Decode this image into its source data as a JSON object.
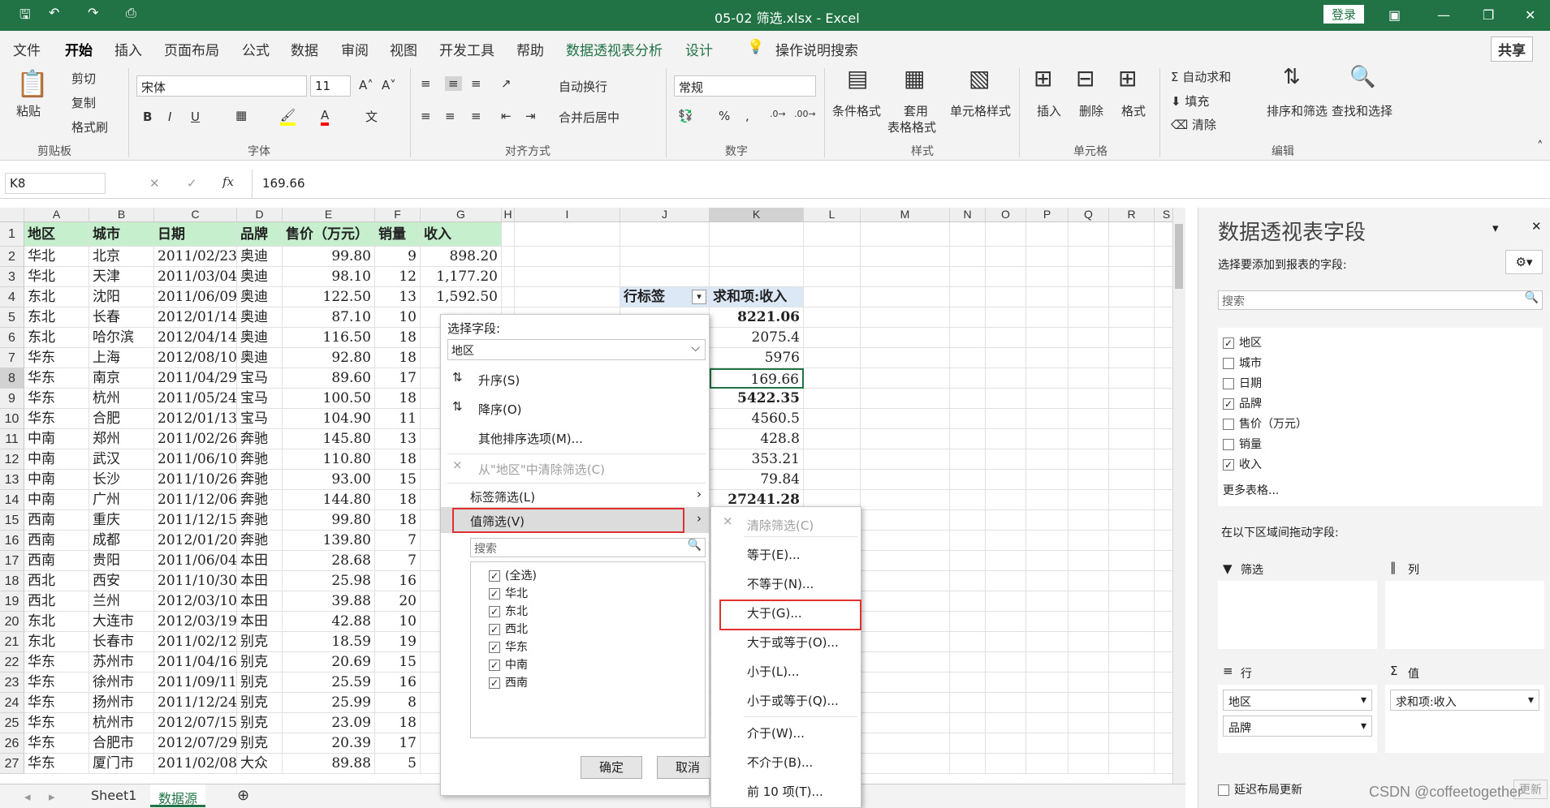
{
  "title": "05-02 筛选.xlsx - Excel",
  "login": "登录",
  "tabs": [
    "文件",
    "开始",
    "插入",
    "页面布局",
    "公式",
    "数据",
    "审阅",
    "视图",
    "开发工具",
    "帮助",
    "数据透视表分析",
    "设计"
  ],
  "tellme": "操作说明搜索",
  "share": "共享",
  "ribbon": {
    "paste": "粘贴",
    "cut": "剪切",
    "copy": "复制",
    "format_painter": "格式刷",
    "clipboard": "剪贴板",
    "font_name": "宋体",
    "font_size": "11",
    "font_group": "字体",
    "wrap": "自动换行",
    "merge": "合并后居中",
    "align_group": "对齐方式",
    "number_format": "常规",
    "number_group": "数字",
    "cond_format": "条件格式",
    "table_format_1": "套用",
    "table_format_2": "表格格式",
    "cell_style": "单元格样式",
    "style_group": "样式",
    "insert": "插入",
    "delete": "删除",
    "format": "格式",
    "cells_group": "单元格",
    "autosum": "自动求和",
    "fill": "填充",
    "clear": "清除",
    "sort_filter": "排序和筛选",
    "find_select": "查找和选择",
    "edit_group": "编辑"
  },
  "formula_bar": {
    "namebox": "K8",
    "formula": "169.66"
  },
  "columns": [
    "A",
    "B",
    "C",
    "D",
    "E",
    "F",
    "G",
    "H",
    "I",
    "J",
    "K",
    "L",
    "M",
    "N",
    "O",
    "P",
    "Q",
    "R",
    "S"
  ],
  "headers": [
    "地区",
    "城市",
    "日期",
    "品牌",
    "售价（万元）",
    "销量",
    "收入"
  ],
  "rows": [
    [
      "华北",
      "北京",
      "2011/02/23",
      "奥迪",
      "99.80",
      "9",
      "898.20"
    ],
    [
      "华北",
      "天津",
      "2011/03/04",
      "奥迪",
      "98.10",
      "12",
      "1,177.20"
    ],
    [
      "东北",
      "沈阳",
      "2011/06/09",
      "奥迪",
      "122.50",
      "13",
      "1,592.50"
    ],
    [
      "东北",
      "长春",
      "2012/01/14",
      "奥迪",
      "87.10",
      "10",
      ""
    ],
    [
      "东北",
      "哈尔滨",
      "2012/04/14",
      "奥迪",
      "116.50",
      "18",
      ""
    ],
    [
      "华东",
      "上海",
      "2012/08/10",
      "奥迪",
      "92.80",
      "18",
      ""
    ],
    [
      "华东",
      "南京",
      "2011/04/29",
      "宝马",
      "89.60",
      "17",
      ""
    ],
    [
      "华东",
      "杭州",
      "2011/05/24",
      "宝马",
      "100.50",
      "18",
      ""
    ],
    [
      "华东",
      "合肥",
      "2012/01/13",
      "宝马",
      "104.90",
      "11",
      ""
    ],
    [
      "中南",
      "郑州",
      "2011/02/26",
      "奔驰",
      "145.80",
      "13",
      ""
    ],
    [
      "中南",
      "武汉",
      "2011/06/10",
      "奔驰",
      "110.80",
      "18",
      ""
    ],
    [
      "中南",
      "长沙",
      "2011/10/26",
      "奔驰",
      "93.00",
      "15",
      ""
    ],
    [
      "中南",
      "广州",
      "2011/12/06",
      "奔驰",
      "144.80",
      "18",
      ""
    ],
    [
      "西南",
      "重庆",
      "2011/12/15",
      "奔驰",
      "99.80",
      "18",
      ""
    ],
    [
      "西南",
      "成都",
      "2012/01/20",
      "奔驰",
      "139.80",
      "7",
      ""
    ],
    [
      "西南",
      "贵阳",
      "2011/06/04",
      "本田",
      "28.68",
      "7",
      ""
    ],
    [
      "西北",
      "西安",
      "2011/10/30",
      "本田",
      "25.98",
      "16",
      ""
    ],
    [
      "西北",
      "兰州",
      "2012/03/10",
      "本田",
      "39.88",
      "20",
      ""
    ],
    [
      "东北",
      "大连市",
      "2012/03/19",
      "本田",
      "42.88",
      "10",
      ""
    ],
    [
      "东北",
      "长春市",
      "2011/02/12",
      "别克",
      "18.59",
      "19",
      ""
    ],
    [
      "华东",
      "苏州市",
      "2011/04/16",
      "别克",
      "20.69",
      "15",
      ""
    ],
    [
      "华东",
      "徐州市",
      "2011/09/11",
      "别克",
      "25.59",
      "16",
      ""
    ],
    [
      "华东",
      "扬州市",
      "2011/12/24",
      "别克",
      "25.99",
      "8",
      ""
    ],
    [
      "华东",
      "杭州市",
      "2012/07/15",
      "别克",
      "23.09",
      "18",
      ""
    ],
    [
      "华东",
      "合肥市",
      "2012/07/29",
      "别克",
      "20.39",
      "17",
      ""
    ],
    [
      "华东",
      "厦门市",
      "2011/02/08",
      "大众",
      "89.88",
      "5",
      ""
    ]
  ],
  "pivot": {
    "row_label": "行标签",
    "sum_label": "求和项:收入",
    "values": [
      "8221.06",
      "2075.4",
      "5976",
      "169.66",
      "5422.35",
      "4560.5",
      "428.8",
      "353.21",
      "79.84",
      "27241.28"
    ]
  },
  "menu": {
    "select_field": "选择字段:",
    "field": "地区",
    "asc": "升序(S)",
    "desc": "降序(O)",
    "more_sort": "其他排序选项(M)...",
    "clear_filter": "从\"地区\"中清除筛选(C)",
    "label_filter": "标签筛选(L)",
    "value_filter": "值筛选(V)",
    "search": "搜索",
    "items": [
      "(全选)",
      "华北",
      "东北",
      "西北",
      "华东",
      "中南",
      "西南"
    ],
    "ok": "确定",
    "cancel": "取消"
  },
  "submenu": [
    "清除筛选(C)",
    "等于(E)...",
    "不等于(N)...",
    "大于(G)...",
    "大于或等于(O)...",
    "小于(L)...",
    "小于或等于(Q)...",
    "介于(W)...",
    "不介于(B)...",
    "前 10 项(T)..."
  ],
  "pane": {
    "title": "数据透视表字段",
    "subtitle": "选择要添加到报表的字段:",
    "search": "搜索",
    "fields": [
      {
        "name": "地区",
        "checked": true
      },
      {
        "name": "城市",
        "checked": false
      },
      {
        "name": "日期",
        "checked": false
      },
      {
        "name": "品牌",
        "checked": true
      },
      {
        "name": "售价（万元）",
        "checked": false
      },
      {
        "name": "销量",
        "checked": false
      },
      {
        "name": "收入",
        "checked": true
      }
    ],
    "more": "更多表格...",
    "drag_hint": "在以下区域间拖动字段:",
    "filter": "筛选",
    "columns": "列",
    "rows": "行",
    "values": "值",
    "row_items": [
      "地区",
      "品牌"
    ],
    "value_items": [
      "求和项:收入"
    ],
    "defer": "延迟布局更新",
    "update": "更新"
  },
  "sheets": [
    "Sheet1",
    "数据源"
  ],
  "watermark": "CSDN @coffeetogether"
}
